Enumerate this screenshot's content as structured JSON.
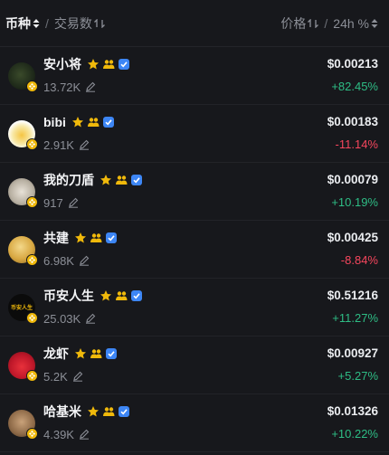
{
  "header": {
    "coin_label": "币种",
    "divider": "/",
    "volume_label": "交易数",
    "price_label": "价格",
    "change_label": "24h %"
  },
  "colors": {
    "up": "#2ebd85",
    "down": "#f6465d",
    "star": "#f0b90b",
    "verified": "#3d86f5"
  },
  "tokens": [
    {
      "name": "安小将",
      "volume": "13.72K",
      "price": "$0.00213",
      "change": "+82.45%",
      "direction": "up",
      "icons": [
        "star-icon",
        "holders-icon",
        "verified-icon"
      ]
    },
    {
      "name": "bibi",
      "volume": "2.91K",
      "price": "$0.00183",
      "change": "-11.14%",
      "direction": "down",
      "icons": [
        "star-icon",
        "holders-icon",
        "verified-icon"
      ]
    },
    {
      "name": "我的刀盾",
      "volume": "917",
      "price": "$0.00079",
      "change": "+10.19%",
      "direction": "up",
      "icons": [
        "star-icon",
        "holders-icon",
        "verified-icon"
      ]
    },
    {
      "name": "共建",
      "volume": "6.98K",
      "price": "$0.00425",
      "change": "-8.84%",
      "direction": "down",
      "icons": [
        "star-icon",
        "holders-icon",
        "verified-icon"
      ]
    },
    {
      "name": "币安人生",
      "volume": "25.03K",
      "price": "$0.51216",
      "change": "+11.27%",
      "direction": "up",
      "icons": [
        "star-icon",
        "holders-icon",
        "verified-icon"
      ],
      "avatar_text": "币安人生"
    },
    {
      "name": "龙虾",
      "volume": "5.2K",
      "price": "$0.00927",
      "change": "+5.27%",
      "direction": "up",
      "icons": [
        "star-icon",
        "holders-icon",
        "verified-icon"
      ]
    },
    {
      "name": "哈基米",
      "volume": "4.39K",
      "price": "$0.01326",
      "change": "+10.22%",
      "direction": "up",
      "icons": [
        "star-icon",
        "holders-icon",
        "verified-icon"
      ]
    }
  ]
}
